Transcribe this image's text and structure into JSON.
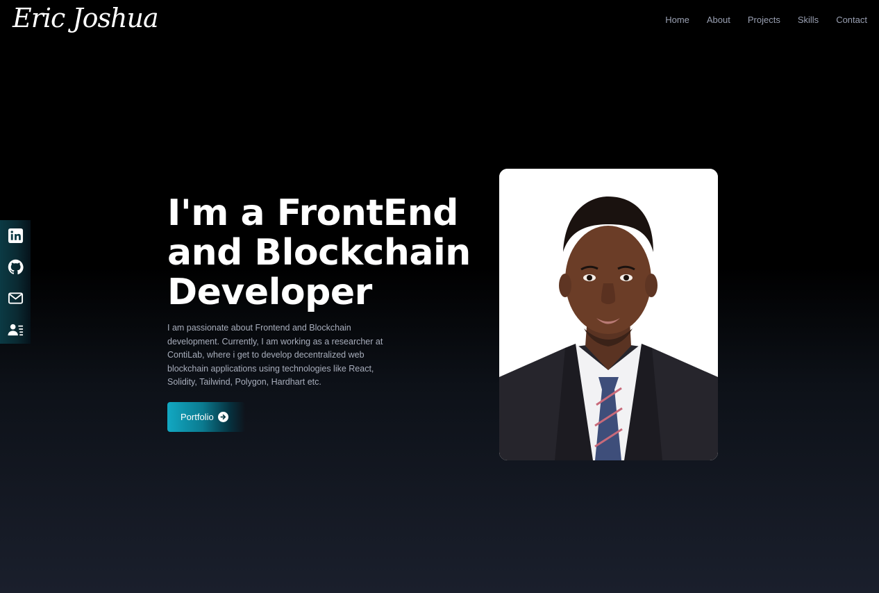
{
  "header": {
    "logo": "Eric Joshua",
    "nav": [
      "Home",
      "About",
      "Projects",
      "Skills",
      "Contact"
    ]
  },
  "social": {
    "icons": [
      "linkedin-icon",
      "github-icon",
      "mail-icon",
      "resume-icon"
    ]
  },
  "hero": {
    "title_lines": [
      "I'm a FrontEnd",
      "and Blockchain",
      "Developer"
    ],
    "description": "I am passionate about Frontend and Blockchain development. Currently, I am working as a researcher at ContiLab, where i get to develop decentralized web blockchain applications using technologies like React, Solidity, Tailwind, Polygon, Hardhart etc.",
    "button_label": "Portfolio"
  },
  "colors": {
    "accent": "#12a8c2",
    "nav_text": "#9aa0b2",
    "body_text": "#a8aebc"
  }
}
